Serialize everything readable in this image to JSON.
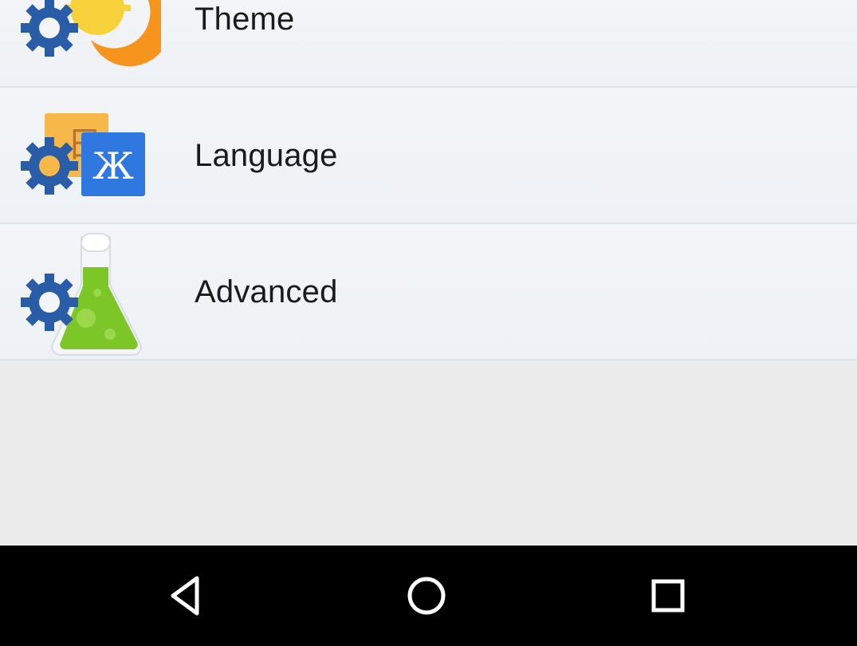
{
  "settings": {
    "items": [
      {
        "label": "Theme",
        "icon": "theme-gear-sun-moon-icon"
      },
      {
        "label": "Language",
        "icon": "language-gear-translate-icon",
        "badge_glyph": "Ж",
        "back_glyph": "日"
      },
      {
        "label": "Advanced",
        "icon": "advanced-gear-flask-icon"
      }
    ]
  },
  "navbar": {
    "back_icon": "back-triangle-icon",
    "home_icon": "home-circle-icon",
    "recents_icon": "recents-square-icon"
  },
  "colors": {
    "gear": "#2a5da8",
    "sun": "#f7d23a",
    "moon": "#f7941d",
    "language_tile_blue": "#2f78e0",
    "language_tile_orange": "#f7b84a",
    "flask_liquid": "#7cc628",
    "list_background": "#f1f3f7",
    "page_background": "#ececec",
    "navbar": "#000000"
  }
}
